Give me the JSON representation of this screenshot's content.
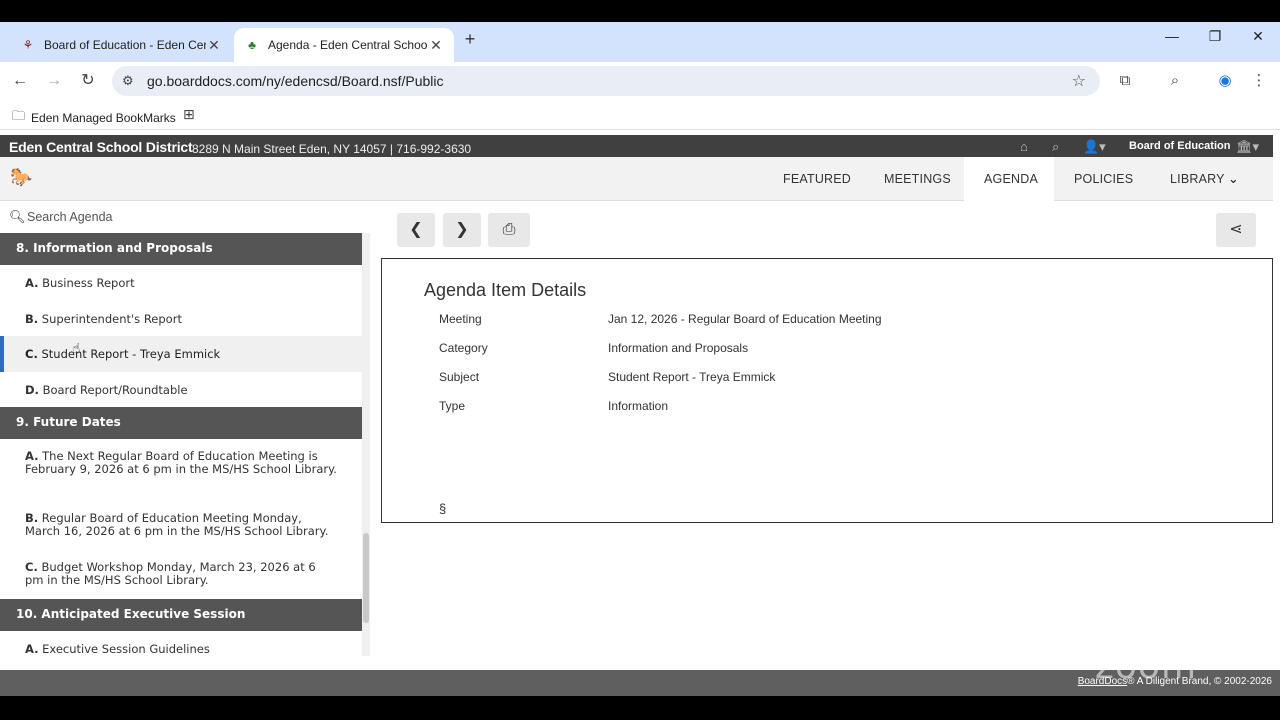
{
  "browser": {
    "tabs": [
      {
        "title": "Board of Education - Eden Cent",
        "close": "✕"
      },
      {
        "title": "Agenda - Eden Central School D",
        "close": "✕"
      }
    ],
    "new_tab": "+",
    "url": "go.boarddocs.com/ny/edencsd/Board.nsf/Public",
    "bookmark": "Eden Managed BookMarks"
  },
  "site": {
    "district": "Eden Central School District",
    "address": "8289 N Main Street Eden, NY 14057 | 716-992-3630",
    "board": "Board of Education"
  },
  "nav": {
    "tabs": [
      {
        "label": "FEATURED"
      },
      {
        "label": "MEETINGS"
      },
      {
        "label": "AGENDA"
      },
      {
        "label": "POLICIES"
      },
      {
        "label": "LIBRARY"
      }
    ]
  },
  "search": {
    "placeholder": "Search Agenda"
  },
  "agenda": {
    "sections": [
      {
        "title": "8. Information and Proposals",
        "items": [
          {
            "letter": "A.",
            "text": "Business Report"
          },
          {
            "letter": "B.",
            "text": "Superintendent's Report"
          },
          {
            "letter": "C.",
            "text": "Student Report - Treya Emmick"
          },
          {
            "letter": "D.",
            "text": "Board Report/Roundtable"
          }
        ]
      },
      {
        "title": "9. Future Dates",
        "items": [
          {
            "letter": "A.",
            "text": "The Next Regular Board of Education Meeting is February 9, 2026 at 6 pm in the MS/HS School Library."
          },
          {
            "letter": "B.",
            "text": "Regular Board of Education Meeting Monday, March 16, 2026 at 6 pm in the MS/HS School Library."
          },
          {
            "letter": "C.",
            "text": "Budget Workshop Monday, March 23, 2026 at 6 pm in the MS/HS School Library."
          }
        ]
      },
      {
        "title": "10. Anticipated Executive Session",
        "items": [
          {
            "letter": "A.",
            "text": "Executive Session Guidelines"
          }
        ]
      }
    ]
  },
  "details": {
    "heading": "Agenda Item Details",
    "rows": [
      {
        "label": "Meeting",
        "value": "Jan 12, 2026 - Regular Board of Education Meeting"
      },
      {
        "label": "Category",
        "value": "Information and Proposals"
      },
      {
        "label": "Subject",
        "value": "Student Report - Treya Emmick"
      },
      {
        "label": "Type",
        "value": "Information"
      }
    ],
    "section_mark": "§"
  },
  "footer": {
    "brand": "BoardDocs",
    "rest": "® A Diligent Brand, © 2002-2026"
  },
  "watermark": "zoom"
}
